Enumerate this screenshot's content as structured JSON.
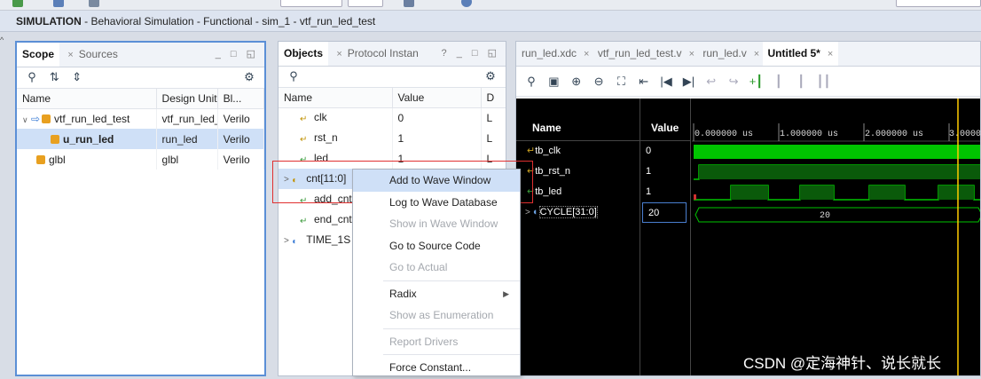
{
  "title_bar": {
    "bold": "SIMULATION",
    "rest": " - Behavioral Simulation - Functional - sim_1 - vtf_run_led_test"
  },
  "scope": {
    "tabs": [
      {
        "label": "Scope"
      },
      {
        "label": "Sources"
      }
    ],
    "close_glyph": "×",
    "win_btns": "_ □ ◱",
    "columns": [
      "Name",
      "Design Unit",
      "Bl..."
    ],
    "rows": [
      {
        "name": "vtf_run_led_test",
        "unit": "vtf_run_led_t",
        "block": "Verilo"
      },
      {
        "name": "u_run_led",
        "unit": "run_led",
        "block": "Verilo"
      },
      {
        "name": "glbl",
        "unit": "glbl",
        "block": "Verilo"
      }
    ]
  },
  "objects": {
    "tabs": [
      {
        "label": "Objects"
      },
      {
        "label": "Protocol Instan"
      }
    ],
    "extra": "?",
    "columns": [
      "Name",
      "Value",
      "D"
    ],
    "rows": [
      {
        "name": "clk",
        "value": "0",
        "d": "L"
      },
      {
        "name": "rst_n",
        "value": "1",
        "d": "L"
      },
      {
        "name": "led",
        "value": "1",
        "d": "L"
      },
      {
        "name": "cnt[11:0]",
        "value": "",
        "d": ""
      },
      {
        "name": "add_cnt",
        "value": "",
        "d": ""
      },
      {
        "name": "end_cnt",
        "value": "",
        "d": ""
      },
      {
        "name": "TIME_1S",
        "value": "",
        "d": ""
      }
    ]
  },
  "wave": {
    "tabs": [
      {
        "label": "run_led.xdc"
      },
      {
        "label": "vtf_run_led_test.v"
      },
      {
        "label": "run_led.v"
      },
      {
        "label": "Untitled 5*"
      }
    ],
    "header_name": "Name",
    "header_value": "Value",
    "time_labels": [
      "0.000000 us",
      "1.000000 us",
      "2.000000 us",
      "3.0000"
    ],
    "signals": [
      {
        "name": "tb_clk",
        "value": "0"
      },
      {
        "name": "tb_rst_n",
        "value": "1"
      },
      {
        "name": "tb_led",
        "value": "1"
      },
      {
        "name": "CYCLE[31:0]",
        "value": "20"
      }
    ],
    "bus_label": "20",
    "colors": {
      "wave_green": "#00c400",
      "background": "#000000",
      "cursor": "#ffcc00"
    }
  },
  "context_menu": {
    "items": [
      {
        "label": "Add to Wave Window",
        "enabled": true
      },
      {
        "label": "Log to Wave Database",
        "enabled": true
      },
      {
        "label": "Show in Wave Window",
        "enabled": false
      },
      {
        "label": "Go to Source Code",
        "enabled": true
      },
      {
        "label": "Go to Actual",
        "enabled": false
      },
      {
        "label": "Radix",
        "enabled": true
      },
      {
        "label": "Show as Enumeration",
        "enabled": false
      },
      {
        "label": "Report Drivers",
        "enabled": false
      },
      {
        "label": "Force Constant...",
        "enabled": true
      }
    ]
  },
  "watermark": "CSDN @定海神针、说长就长"
}
